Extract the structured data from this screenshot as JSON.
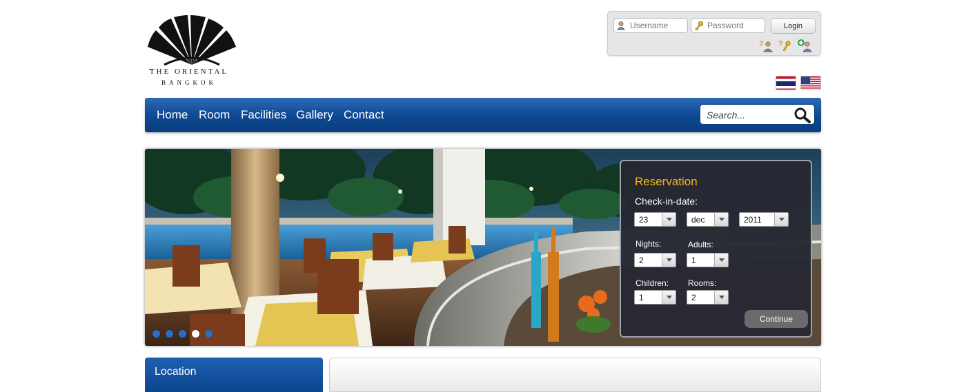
{
  "logo": {
    "line1": "THE ORIENTAL",
    "line2": "BANGKOK"
  },
  "login": {
    "username_placeholder": "Username",
    "password_placeholder": "Password",
    "login_label": "Login",
    "icons": [
      "forgot-username-icon",
      "forgot-password-icon",
      "register-user-icon"
    ]
  },
  "flags": [
    "thai-flag-icon",
    "us-flag-icon"
  ],
  "nav": {
    "items": [
      "Home",
      "Room",
      "Facilities",
      "Gallery",
      "Contact"
    ],
    "search_placeholder": "Search..."
  },
  "banner": {
    "slide_count": 5,
    "active_slide": 4
  },
  "reservation": {
    "title": "Reservation",
    "checkin_label": "Check-in-date:",
    "day": "23",
    "month": "dec",
    "year": "2011",
    "nights_label": "Nights:",
    "nights": "2",
    "adults_label": "Adults:",
    "adults": "1",
    "children_label": "Children:",
    "children": "1",
    "rooms_label": "Rooms:",
    "rooms": "2",
    "continue_label": "Continue"
  },
  "location": {
    "title": "Location"
  },
  "colors": {
    "nav_blue": "#0f4a93",
    "reservation_title": "#f2b61c",
    "dot_blue": "#2a6ec2"
  }
}
